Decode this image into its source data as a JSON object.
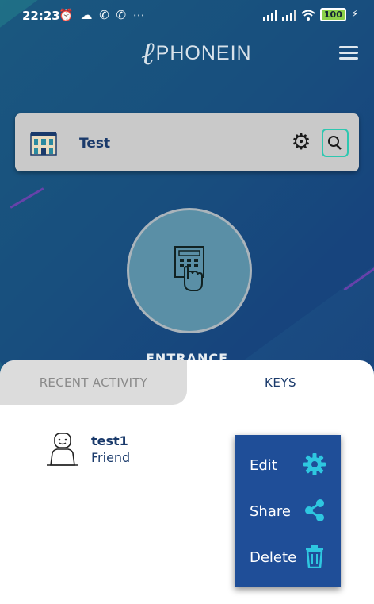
{
  "status_bar": {
    "time": "22:23",
    "left_icons": "⏰ ☁ ✆ ✆ ⋯",
    "battery": "100"
  },
  "header": {
    "logo_mark": "ℓ",
    "logo_text": "PHONEIN"
  },
  "site_card": {
    "name": "Test"
  },
  "entrance": {
    "label": "ENTRANCE"
  },
  "tabs": {
    "recent": "RECENT ACTIVITY",
    "keys": "KEYS"
  },
  "keys_list": [
    {
      "name": "test1",
      "role": "Friend"
    }
  ],
  "context_menu": {
    "items": [
      {
        "label": "Edit",
        "icon": "gear-icon"
      },
      {
        "label": "Share",
        "icon": "share-icon"
      },
      {
        "label": "Delete",
        "icon": "trash-icon"
      }
    ]
  },
  "colors": {
    "accent": "#2ec7b0",
    "menu_bg": "#1f4e98",
    "brand_text": "#1a3a6b"
  }
}
